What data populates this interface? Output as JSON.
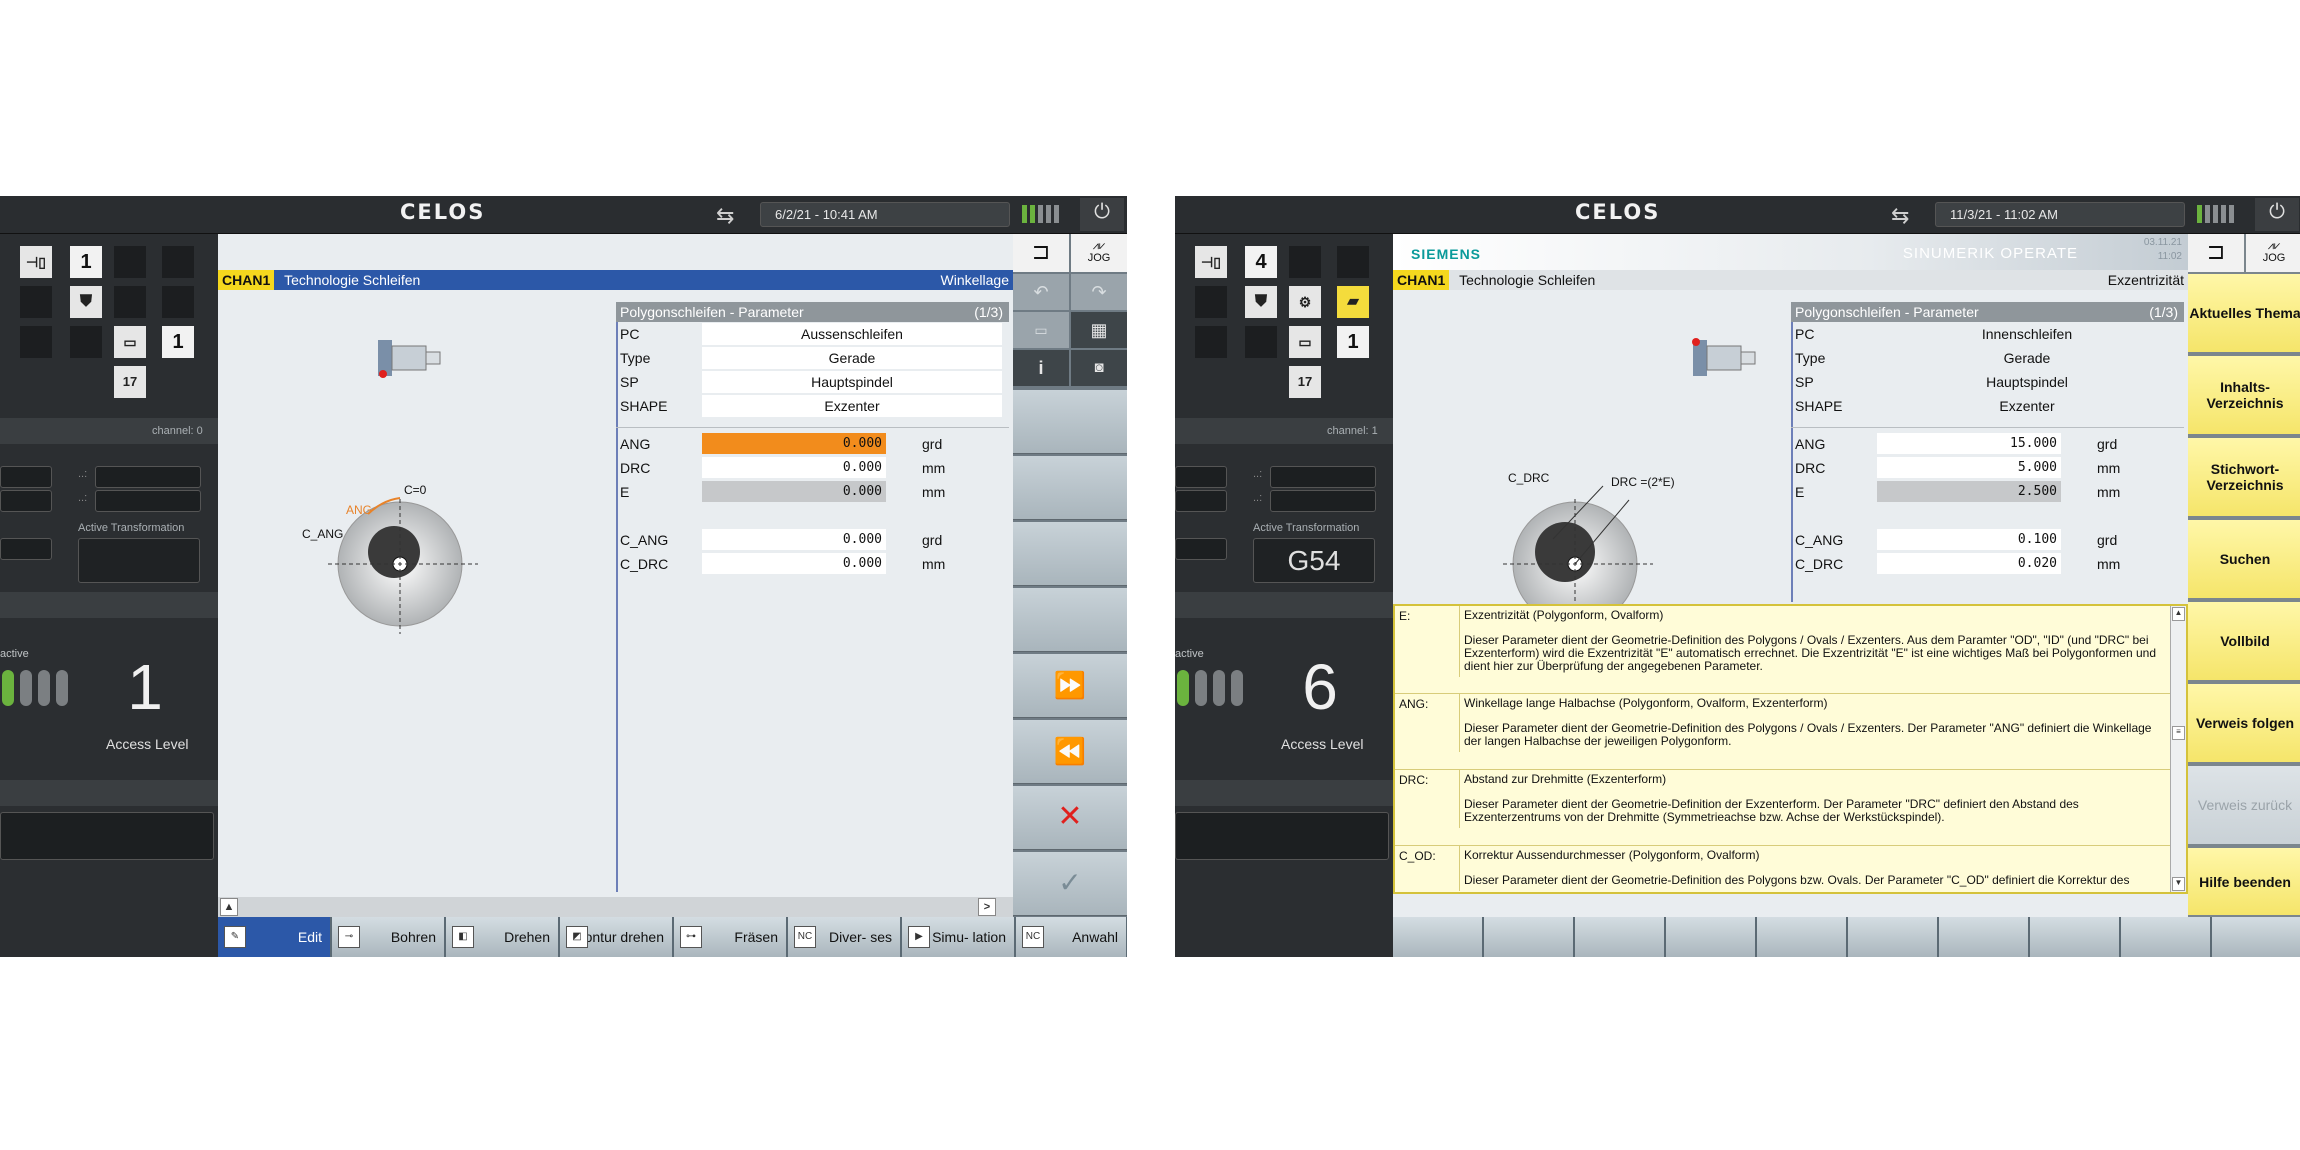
{
  "left": {
    "celos": "CELOS",
    "datetime": "6/2/21 - 10:41 AM",
    "channel_label": "channel: 0",
    "active_transformation": "Active Transformation",
    "active_word": "active",
    "num_top": "1",
    "num_mid": "1",
    "calendar": "17",
    "access_number": "1",
    "access_label": "Access Level",
    "chan": "CHAN1",
    "chan_title": "Technologie Schleifen",
    "chan_right": "Winkellage",
    "params_title": "Polygonschleifen - Parameter",
    "params_page": "(1/3)",
    "rows": [
      {
        "label": "PC",
        "value": "Aussenschleifen"
      },
      {
        "label": "Type",
        "value": "Gerade"
      },
      {
        "label": "SP",
        "value": "Hauptspindel"
      },
      {
        "label": "SHAPE",
        "value": "Exzenter"
      }
    ],
    "nums": [
      {
        "label": "ANG",
        "value": "0.000",
        "unit": "grd"
      },
      {
        "label": "DRC",
        "value": "0.000",
        "unit": "mm"
      },
      {
        "label": "E",
        "value": "0.000",
        "unit": "mm"
      },
      {
        "label": "C_ANG",
        "value": "0.000",
        "unit": "grd"
      },
      {
        "label": "C_DRC",
        "value": "0.000",
        "unit": "mm"
      }
    ],
    "diagram": {
      "c0": "C=0",
      "ang": "ANG",
      "cang": "C_ANG"
    },
    "jog": "JOG",
    "info": "i",
    "softkeys": [
      "Edit",
      "Bohren",
      "Drehen",
      "Kontur drehen",
      "Fräsen",
      "Diver- ses",
      "Simu- lation",
      "Anwahl"
    ],
    "nc": "NC"
  },
  "right": {
    "celos": "CELOS",
    "datetime": "11/3/21 - 11:02 AM",
    "siemens": "SIEMENS",
    "sinumerik": "SINUMERIK OPERATE",
    "sin_date": "03.11.21",
    "sin_time": "11:02",
    "channel_label": "channel: 1",
    "active_transformation": "Active Transformation",
    "g54": "G54",
    "active_word": "active",
    "num_top": "4",
    "num_mid": "1",
    "calendar": "17",
    "access_number": "6",
    "access_label": "Access Level",
    "chan": "CHAN1",
    "chan_title": "Technologie Schleifen",
    "chan_right": "Exzentrizität",
    "params_title": "Polygonschleifen - Parameter",
    "params_page": "(1/3)",
    "rows": [
      {
        "label": "PC",
        "value": "Innenschleifen"
      },
      {
        "label": "Type",
        "value": "Gerade"
      },
      {
        "label": "SP",
        "value": "Hauptspindel"
      },
      {
        "label": "SHAPE",
        "value": "Exzenter"
      }
    ],
    "nums": [
      {
        "label": "ANG",
        "value": "15.000",
        "unit": "grd"
      },
      {
        "label": "DRC",
        "value": "5.000",
        "unit": "mm"
      },
      {
        "label": "E",
        "value": "2.500",
        "unit": "mm"
      },
      {
        "label": "C_ANG",
        "value": "0.100",
        "unit": "grd"
      },
      {
        "label": "C_DRC",
        "value": "0.020",
        "unit": "mm"
      }
    ],
    "diagram": {
      "cdrc": "C_DRC",
      "drc": "DRC =(2*E)"
    },
    "jog": "JOG",
    "side_buttons": [
      "Aktuelles Thema",
      "Inhalts- Verzeichnis",
      "Stichwort- Verzeichnis",
      "Suchen",
      "Vollbild",
      "Verweis folgen",
      "Verweis zurück",
      "Hilfe beenden"
    ],
    "help": [
      {
        "key": "E:",
        "title": "Exzentrizität (Polygonform, Ovalform)",
        "text": "Dieser Parameter dient der Geometrie-Definition des Polygons / Ovals / Exzenters. Aus dem Paramter \"OD\", \"ID\" (und \"DRC\" bei Exzenterform) wird die Exzentrizität \"E\" automatisch errechnet. Die Exzentrizität \"E\" ist eine wichtiges Maß bei Polygonformen und dient hier zur Überprüfung der angegebenen Parameter."
      },
      {
        "key": "ANG:",
        "title": "Winkellage lange Halbachse (Polygonform, Ovalform, Exzenterform)",
        "text": "Dieser Parameter dient der Geometrie-Definition des Polygons / Ovals / Exzenters. Der Parameter \"ANG\" definiert die Winkellage der langen Halbachse der jeweiligen Polygonform."
      },
      {
        "key": "DRC:",
        "title": "Abstand zur Drehmitte (Exzenterform)",
        "text": "Dieser Parameter dient der Geometrie-Definition der Exzenterform. Der Parameter \"DRC\" definiert den Abstand des Exzenterzentrums von der Drehmitte (Symmetrieachse bzw. Achse der Werkstückspindel)."
      },
      {
        "key": "C_OD:",
        "title": "Korrektur Aussendurchmesser (Polygonform, Ovalform)",
        "text": "Dieser Parameter dient der Geometrie-Definition des Polygons bzw. Ovals. Der Parameter \"C_OD\" definiert die Korrektur des"
      }
    ]
  },
  "colors": {
    "accent_blue": "#2c58a8",
    "highlight_orange": "#f28c1c",
    "chan_yellow": "#f5d81e",
    "green_led": "#6bb33e"
  }
}
